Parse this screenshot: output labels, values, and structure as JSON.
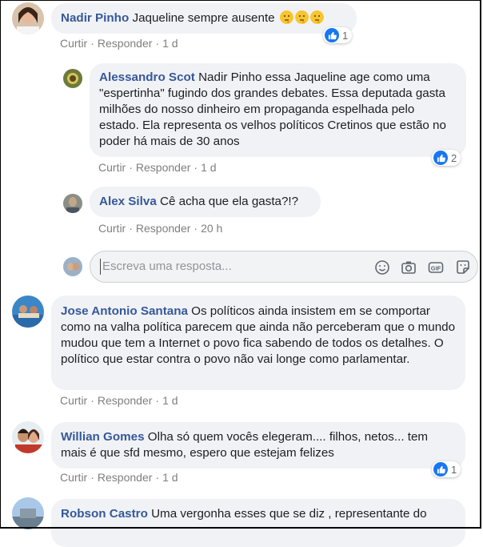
{
  "actions": {
    "like": "Curtir",
    "reply": "Responder",
    "sep": "·"
  },
  "comments": [
    {
      "author": "Nadir Pinho",
      "text": "Jaqueline sempre ausente",
      "emoji_count": 3,
      "time": "1 d",
      "reactions": "1"
    },
    {
      "author": "Alessandro Scot",
      "text": "Nadir Pinho essa Jaqueline age como uma \"espertinha\" fugindo dos grandes debates. Essa deputada gasta milhões do nosso dinheiro em propaganda espelhada pelo estado. Ela representa os velhos políticos Cretinos que estão no poder há mais de 30 anos",
      "time": "1 d",
      "reactions": "2"
    },
    {
      "author": "Alex Silva",
      "text": "Cê acha que ela gasta?!?",
      "time": "20 h"
    },
    {
      "author": "Jose Antonio Santana",
      "text": "Os políticos ainda insistem em se comportar como na valha política parecem que ainda não perceberam que o mundo mudou que tem a Internet o povo fica sabendo de todos os detalhes. O político que estar contra o povo não vai longe como parlamentar.",
      "time": "1 d"
    },
    {
      "author": "Willian Gomes",
      "text": "Olha só quem vocês elegeram.... filhos, netos... tem mais é que sfd mesmo, espero que estejam felizes",
      "time": "1 d",
      "reactions": "1"
    },
    {
      "author": "Robson Castro",
      "text": "Uma vergonha esses que se diz , representante do"
    }
  ],
  "reply_box": {
    "placeholder": "Escreva uma resposta..."
  },
  "icons": [
    "emoji-icon",
    "camera-icon",
    "gif-icon",
    "sticker-icon",
    "like-icon"
  ],
  "colors": {
    "author": "#365899",
    "bubble": "#f0f2f5",
    "like_blue": "#1877f2",
    "meta": "#7f7f7f"
  }
}
